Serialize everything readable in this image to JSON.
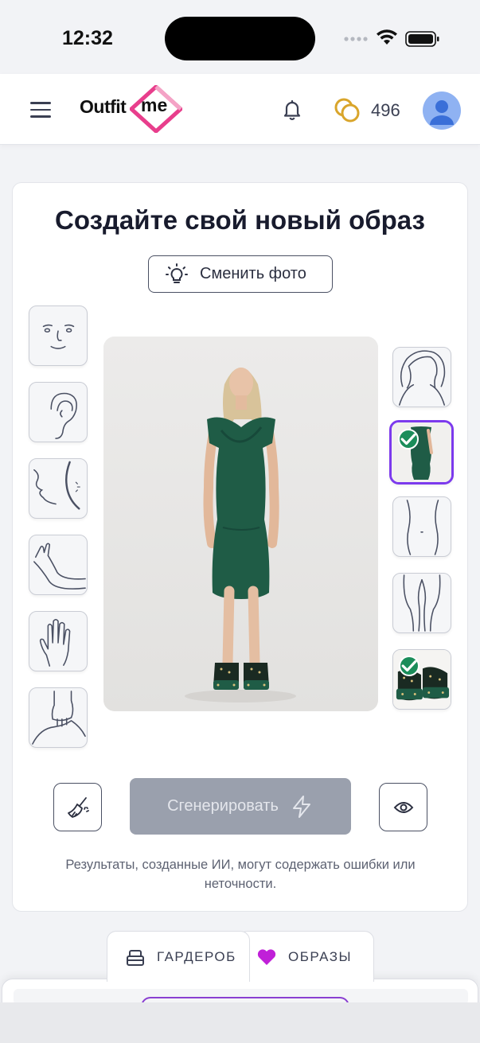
{
  "status_bar": {
    "time": "12:32"
  },
  "header": {
    "logo_part1": "Outfit",
    "logo_part2": "me",
    "coin_count": "496"
  },
  "main": {
    "title": "Создайте свой новый образ",
    "change_photo_label": "Сменить фото",
    "generate_label": "Сгенерировать",
    "disclaimer": "Результаты, созданные ИИ, могут содержать ошибки или неточности."
  },
  "left_tiles": [
    {
      "name": "face",
      "icon": "face-icon"
    },
    {
      "name": "ear",
      "icon": "ear-icon"
    },
    {
      "name": "neck",
      "icon": "neck-icon"
    },
    {
      "name": "arm",
      "icon": "arm-icon"
    },
    {
      "name": "hand",
      "icon": "hand-icon"
    },
    {
      "name": "wrist",
      "icon": "wrist-icon"
    }
  ],
  "right_tiles": [
    {
      "name": "head",
      "icon": "head-icon",
      "selected": false
    },
    {
      "name": "dress",
      "icon": "dress-thumbnail",
      "selected": true
    },
    {
      "name": "waist",
      "icon": "waist-icon",
      "selected": false
    },
    {
      "name": "legs",
      "icon": "legs-icon",
      "selected": false
    },
    {
      "name": "shoes",
      "icon": "shoes-thumbnail",
      "selected": false,
      "checked": true
    }
  ],
  "tabs": {
    "wardrobe": "ГАРДЕРОБ",
    "outfits": "ОБРАЗЫ"
  },
  "colors": {
    "accent_purple": "#7c3aed",
    "check_green": "#1b8d5a",
    "heart_magenta": "#c020d8",
    "logo_pink": "#e83e8c",
    "dress_green": "#1f5c46",
    "generate_disabled": "#9aa0ad"
  }
}
